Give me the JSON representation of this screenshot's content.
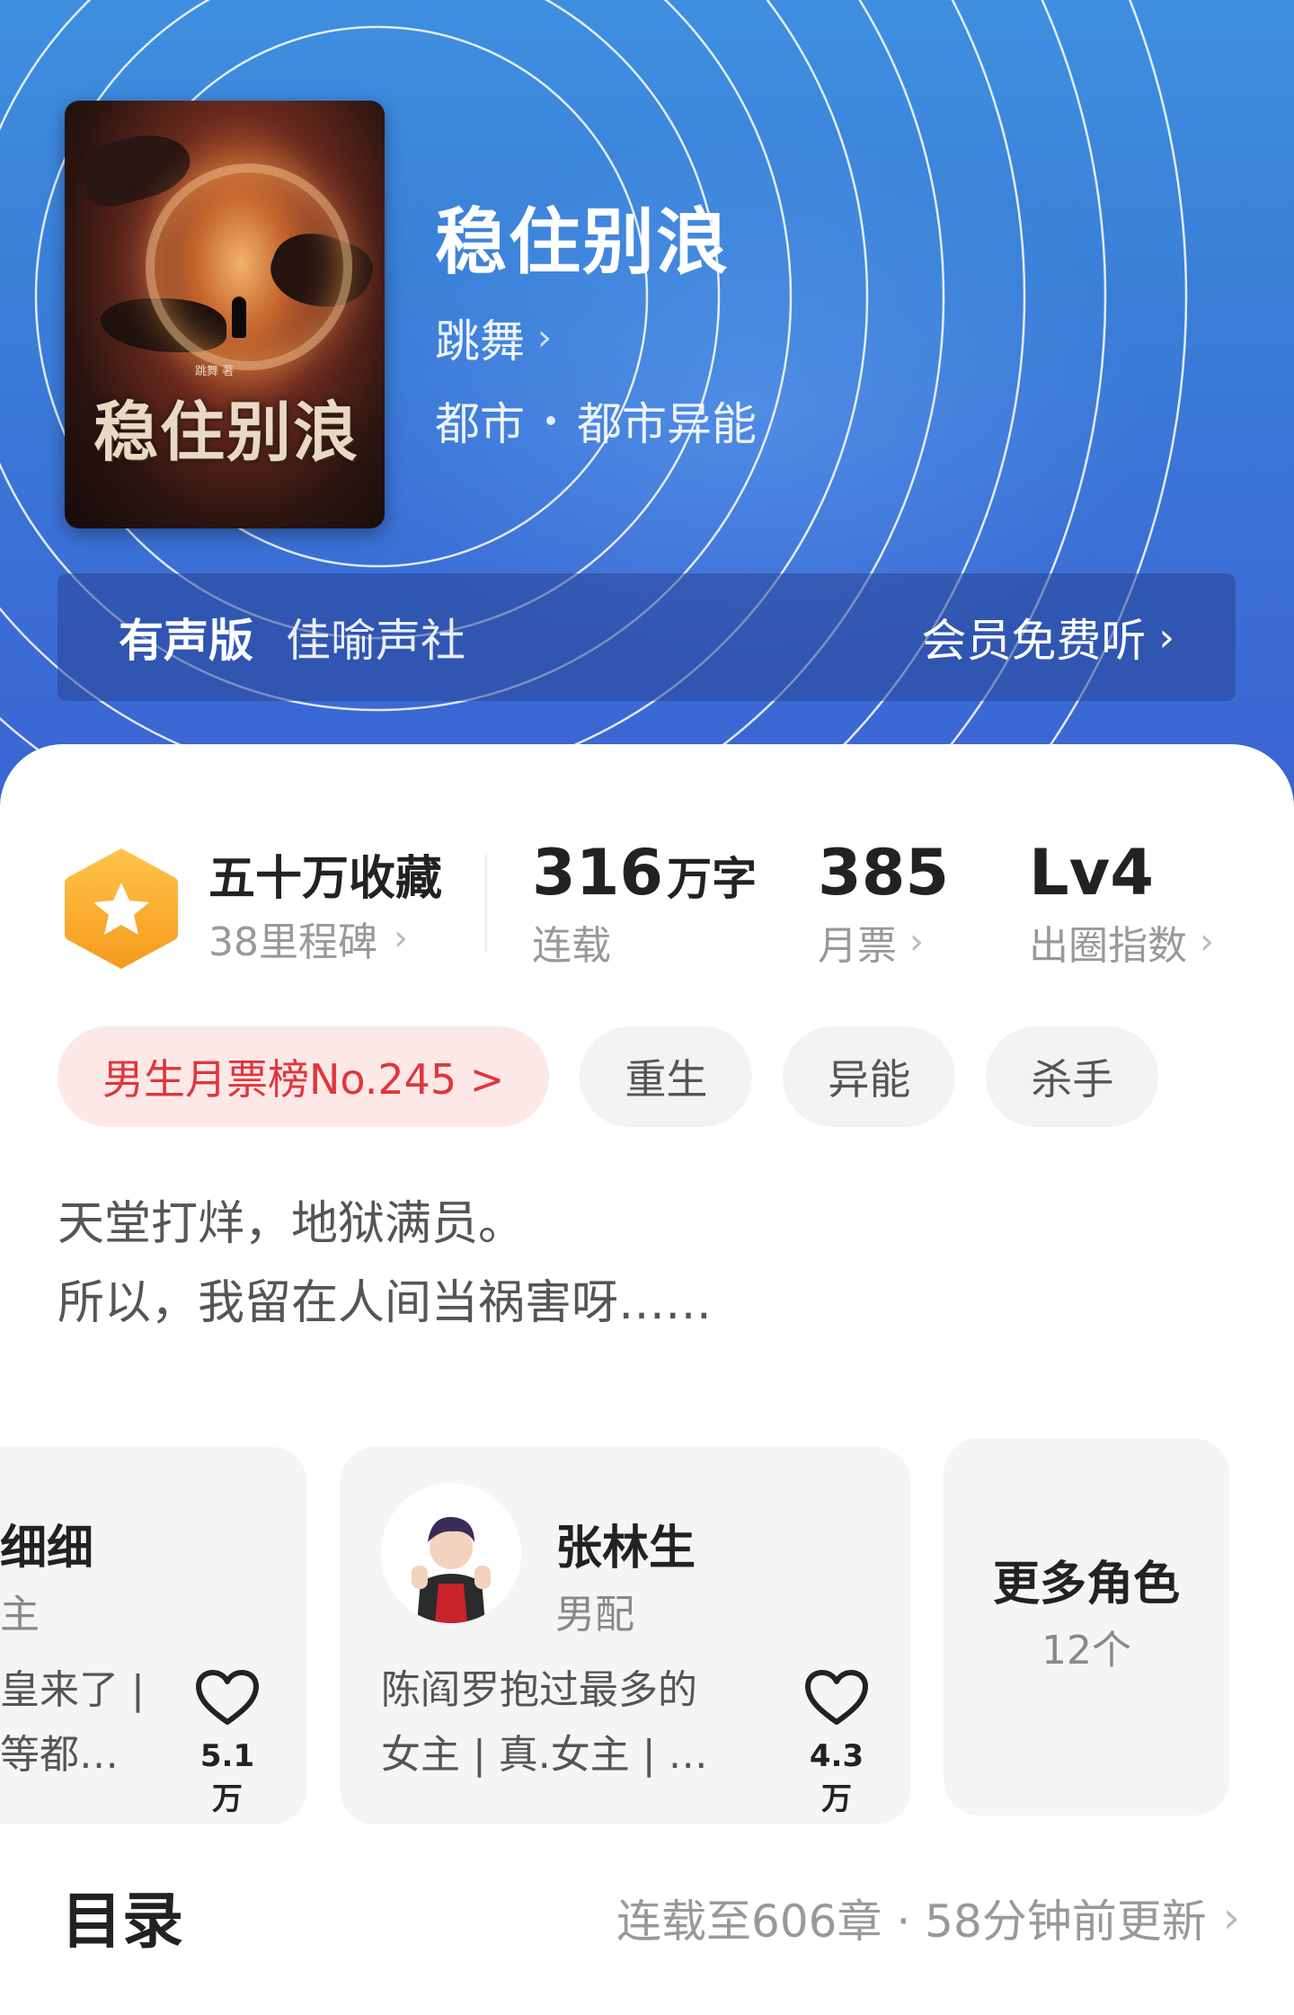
{
  "book": {
    "title": "稳住别浪",
    "author": "跳舞",
    "genre": [
      "都市",
      "都市异能"
    ],
    "cover_title": "稳住别浪",
    "cover_author_tag": "跳舞 著"
  },
  "audio": {
    "label": "有声版",
    "publisher": "佳喻声社",
    "cta": "会员免费听"
  },
  "stats": {
    "favorites": "五十万收藏",
    "milestones": "38里程碑",
    "words_value": "316",
    "words_unit": "万字",
    "words_status": "连载",
    "tickets_value": "385",
    "tickets_label": "月票",
    "level_value": "Lv4",
    "level_label": "出圈指数"
  },
  "tags": {
    "rank": "男生月票榜No.245 >",
    "items": [
      "重生",
      "异能",
      "杀手"
    ]
  },
  "intro": {
    "line1": "天堂打烊，地狱满员。",
    "line2": "所以，我留在人间当祸害呀……"
  },
  "characters": [
    {
      "name": "细细",
      "role": "主",
      "desc1": "皇来了 |",
      "desc2": "等都…",
      "likes": "5.1万"
    },
    {
      "name": "张林生",
      "role": "男配",
      "desc1": "陈阎罗抱过最多的",
      "desc2": "女主 | 真.女主 | …",
      "likes": "4.3万"
    }
  ],
  "more_characters": {
    "label": "更多角色",
    "count": "12个"
  },
  "toc": {
    "title": "目录",
    "status": "连载至606章 · 58分钟前更新"
  },
  "colors": {
    "header_blue": "#3a7fd8",
    "rank_red": "#e0363b",
    "badge_orange": "#f7b23b"
  }
}
